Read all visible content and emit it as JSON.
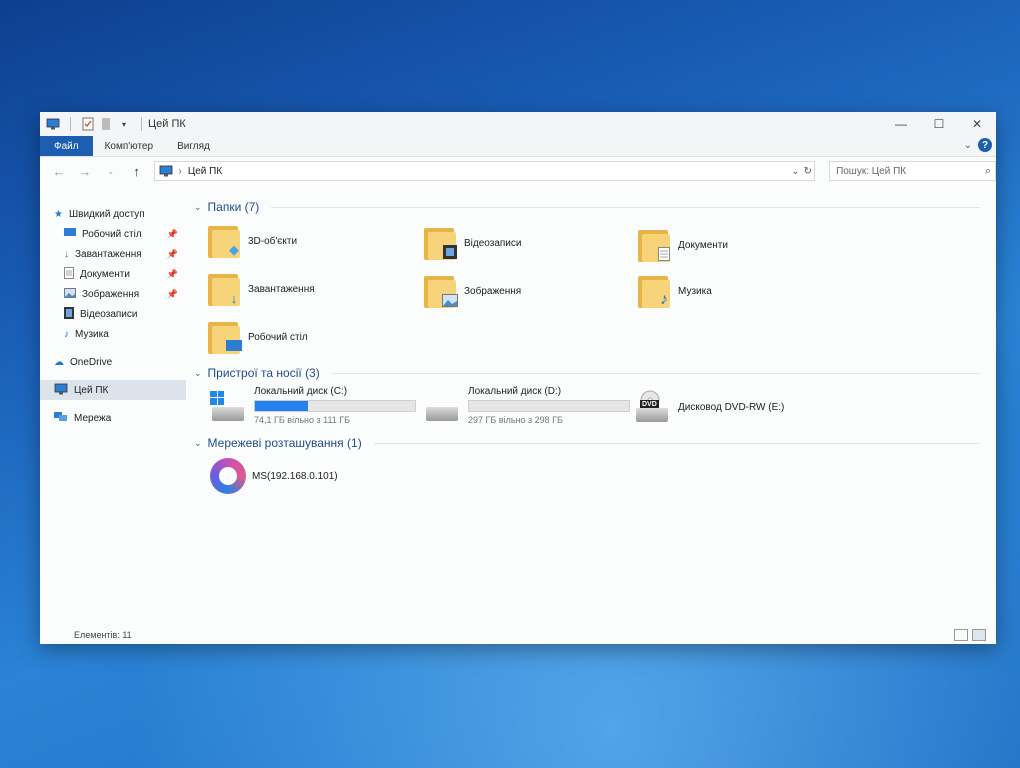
{
  "window": {
    "title": "Цей ПК"
  },
  "ribbon": {
    "tabs": [
      "Файл",
      "Комп'ютер",
      "Вигляд"
    ]
  },
  "address": {
    "path": "Цей ПК"
  },
  "search": {
    "placeholder": "Пошук: Цей ПК"
  },
  "sidebar": {
    "quick_access": "Швидкий доступ",
    "items": [
      {
        "label": "Робочий стіл",
        "pinned": true
      },
      {
        "label": "Завантаження",
        "pinned": true
      },
      {
        "label": "Документи",
        "pinned": true
      },
      {
        "label": "Зображення",
        "pinned": true
      },
      {
        "label": "Відеозаписи",
        "pinned": false
      },
      {
        "label": "Музика",
        "pinned": false
      }
    ],
    "onedrive": "OneDrive",
    "this_pc": "Цей ПК",
    "network": "Мережа"
  },
  "groups": {
    "folders": "Папки (7)",
    "devices": "Пристрої та носії (3)",
    "network": "Мережеві розташування (1)"
  },
  "folders": [
    "3D-об'єкти",
    "Відеозаписи",
    "Документи",
    "Завантаження",
    "Зображення",
    "Музика",
    "Робочий стіл"
  ],
  "drives": [
    {
      "name": "Локальний диск (C:)",
      "free": "74,1 ГБ вільно з 111 ГБ",
      "used_fraction": 0.33
    },
    {
      "name": "Локальний диск (D:)",
      "free": "297 ГБ вільно з 298 ГБ",
      "used_fraction": 0.0
    },
    {
      "name": "Дисковод DVD-RW (E:)",
      "label": "DVD"
    }
  ],
  "network_location": "MS(192.168.0.101)",
  "status": {
    "items": "Елементів: 11"
  }
}
